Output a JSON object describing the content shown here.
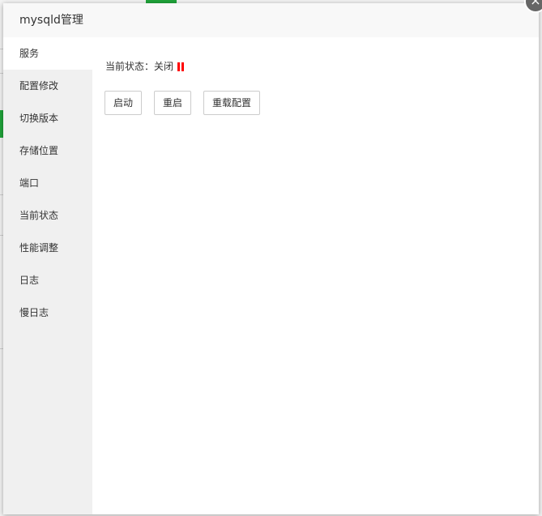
{
  "dialog": {
    "title": "mysqld管理",
    "close_glyph": "×"
  },
  "sidebar": {
    "items": [
      {
        "label": "服务",
        "active": true
      },
      {
        "label": "配置修改"
      },
      {
        "label": "切换版本"
      },
      {
        "label": "存储位置"
      },
      {
        "label": "端口"
      },
      {
        "label": "当前状态"
      },
      {
        "label": "性能调整"
      },
      {
        "label": "日志"
      },
      {
        "label": "慢日志"
      }
    ]
  },
  "service": {
    "status_label": "当前状态：关闭",
    "status_icon": "pause-icon",
    "status_color": "#ff0000",
    "buttons": {
      "start": "启动",
      "restart": "重启",
      "reload": "重载配置"
    }
  },
  "colors": {
    "accent_green": "#20a53a",
    "sidebar_bg": "#f0f0f0"
  }
}
